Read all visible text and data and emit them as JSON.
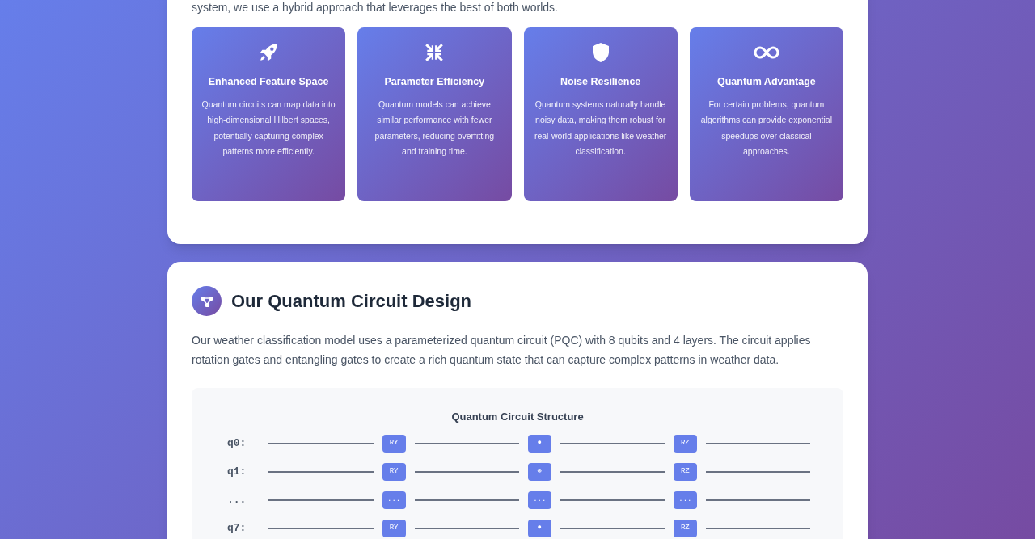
{
  "intro_tail": "system, we use a hybrid approach that leverages the best of both worlds.",
  "features": [
    {
      "title": "Enhanced Feature Space",
      "text": "Quantum circuits can map data into high-dimensional Hilbert spaces, potentially capturing complex patterns more efficiently."
    },
    {
      "title": "Parameter Efficiency",
      "text": "Quantum models can achieve similar performance with fewer parameters, reducing overfitting and training time."
    },
    {
      "title": "Noise Resilience",
      "text": "Quantum systems naturally handle noisy data, making them robust for real-world applications like weather classification."
    },
    {
      "title": "Quantum Advantage",
      "text": "For certain problems, quantum algorithms can provide exponential speedups over classical approaches."
    }
  ],
  "design": {
    "title": "Our Quantum Circuit Design",
    "text": "Our weather classification model uses a parameterized quantum circuit (PQC) with 8 qubits and 4 layers. The circuit applies rotation gates and entangling gates to create a rich quantum state that can capture complex patterns in weather data.",
    "circuit": {
      "title": "Quantum Circuit Structure",
      "rows": [
        {
          "label": "q0:",
          "gates": [
            "RY",
            "●",
            "RZ"
          ]
        },
        {
          "label": "q1:",
          "gates": [
            "RY",
            "⊕",
            "RZ"
          ]
        },
        {
          "label": "...",
          "gates": [
            "...",
            "...",
            "..."
          ]
        },
        {
          "label": "q7:",
          "gates": [
            "RY",
            "●",
            "RZ"
          ]
        }
      ]
    }
  }
}
